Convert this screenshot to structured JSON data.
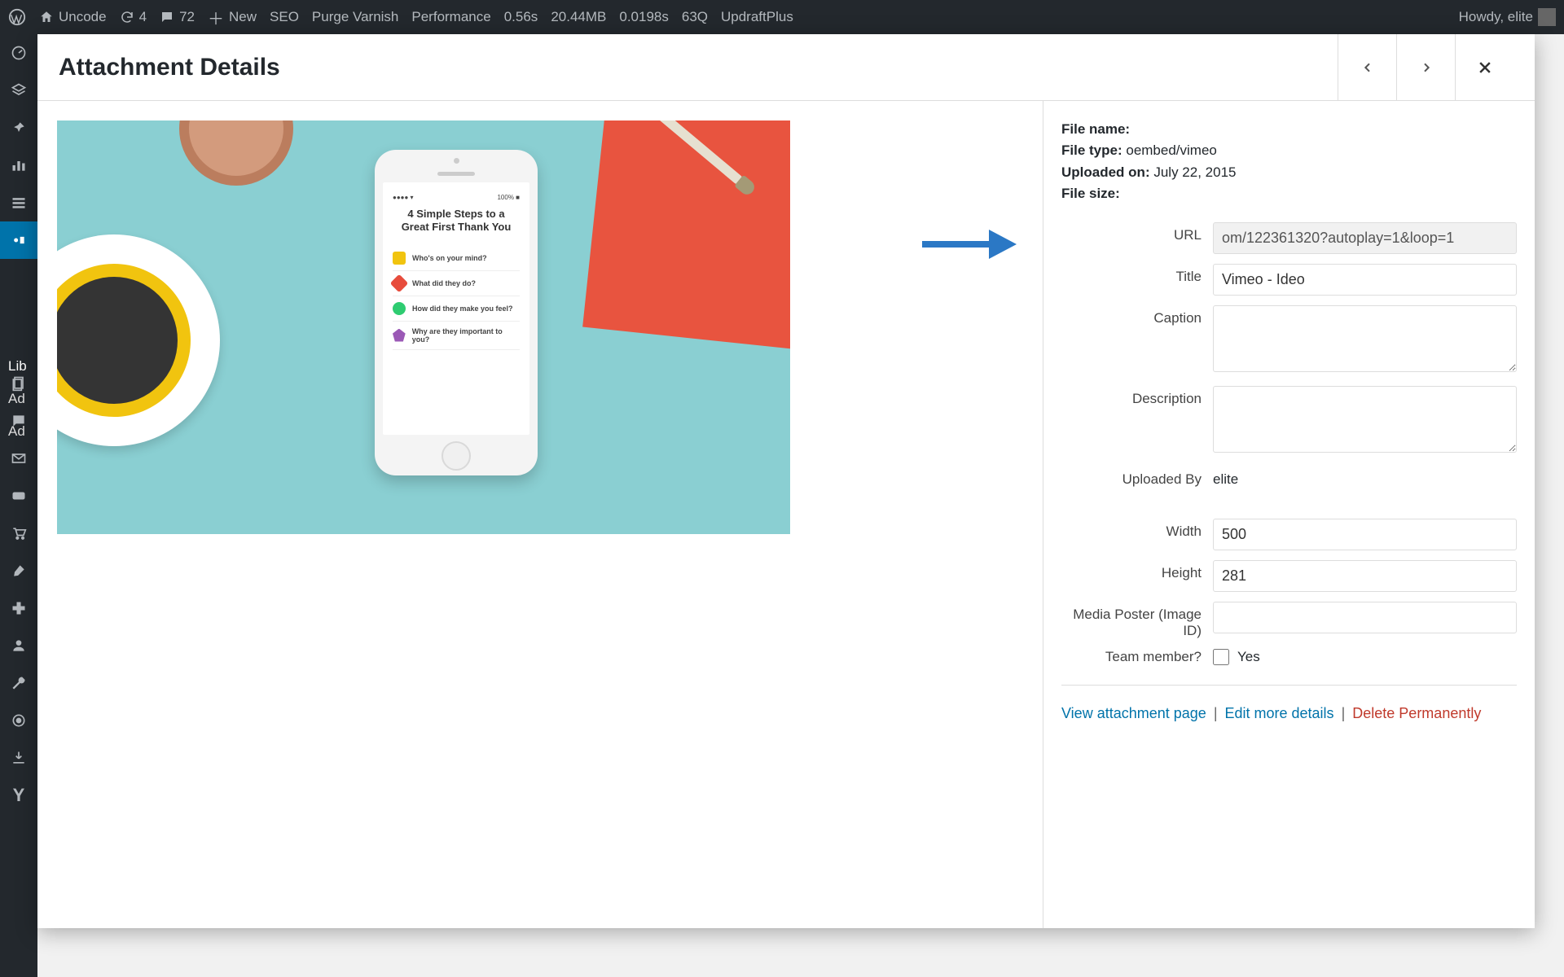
{
  "adminbar": {
    "site": "Uncode",
    "refresh_count": "4",
    "comments_count": "72",
    "new_label": "New",
    "seo": "SEO",
    "purge": "Purge Varnish",
    "perf": "Performance",
    "time": "0.56s",
    "mem": "20.44MB",
    "db": "0.0198s",
    "queries": "63Q",
    "updraft": "UpdraftPlus",
    "howdy": "Howdy, elite"
  },
  "leftrail_flyout": {
    "lib": "Lib",
    "add1": "Ad",
    "add2": "Ad"
  },
  "modal": {
    "title": "Attachment Details"
  },
  "meta": {
    "filename_label": "File name:",
    "filename": "",
    "filetype_label": "File type:",
    "filetype": "oembed/vimeo",
    "uploaded_label": "Uploaded on:",
    "uploaded": "July 22, 2015",
    "filesize_label": "File size:",
    "filesize": ""
  },
  "fields": {
    "url_label": "URL",
    "url_value": "om/122361320?autoplay=1&loop=1",
    "title_label": "Title",
    "title_value": "Vimeo - Ideo",
    "caption_label": "Caption",
    "caption_value": "",
    "description_label": "Description",
    "description_value": "",
    "uploadedby_label": "Uploaded By",
    "uploadedby_value": "elite",
    "width_label": "Width",
    "width_value": "500",
    "height_label": "Height",
    "height_value": "281",
    "poster_label": "Media Poster (Image ID)",
    "poster_value": "",
    "team_label": "Team member?",
    "team_yes": "Yes"
  },
  "links": {
    "view": "View attachment page",
    "edit": "Edit more details",
    "del": "Delete Permanently"
  },
  "preview": {
    "phone_title": "4 Simple Steps to a Great First Thank You",
    "row1": "Who's on your mind?",
    "row2": "What did they do?",
    "row3": "How did they make you feel?",
    "row4": "Why are they important to you?"
  }
}
